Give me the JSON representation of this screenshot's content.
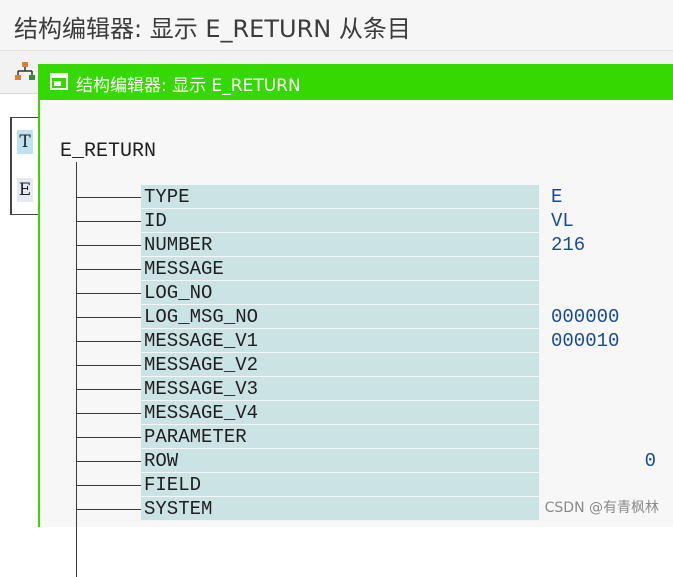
{
  "window": {
    "title": "结构编辑器: 显示 E_RETURN 从条目"
  },
  "toolbar": {
    "icons": [
      "hierarchy-icon",
      "first-icon",
      "previous-icon",
      "next-icon",
      "last-icon",
      "table-icon"
    ]
  },
  "left_columns": {
    "cells": [
      "T",
      "E"
    ]
  },
  "dialog": {
    "title": "结构编辑器: 显示 E_RETURN",
    "root": "E_RETURN",
    "fields": [
      {
        "name": "TYPE",
        "value": "E"
      },
      {
        "name": "ID",
        "value": "VL"
      },
      {
        "name": "NUMBER",
        "value": "216"
      },
      {
        "name": "MESSAGE",
        "value": ""
      },
      {
        "name": "LOG_NO",
        "value": ""
      },
      {
        "name": "LOG_MSG_NO",
        "value": "000000"
      },
      {
        "name": "MESSAGE_V1",
        "value": "000010"
      },
      {
        "name": "MESSAGE_V2",
        "value": ""
      },
      {
        "name": "MESSAGE_V3",
        "value": ""
      },
      {
        "name": "MESSAGE_V4",
        "value": ""
      },
      {
        "name": "PARAMETER",
        "value": ""
      },
      {
        "name": "ROW",
        "value": "0"
      },
      {
        "name": "FIELD",
        "value": ""
      },
      {
        "name": "SYSTEM",
        "value": ""
      }
    ]
  },
  "watermark": "CSDN @有青枫林",
  "colors": {
    "dialog_titlebar": "#35d800",
    "field_background": "#cbe3e3",
    "value_text": "#1a4b9a"
  }
}
